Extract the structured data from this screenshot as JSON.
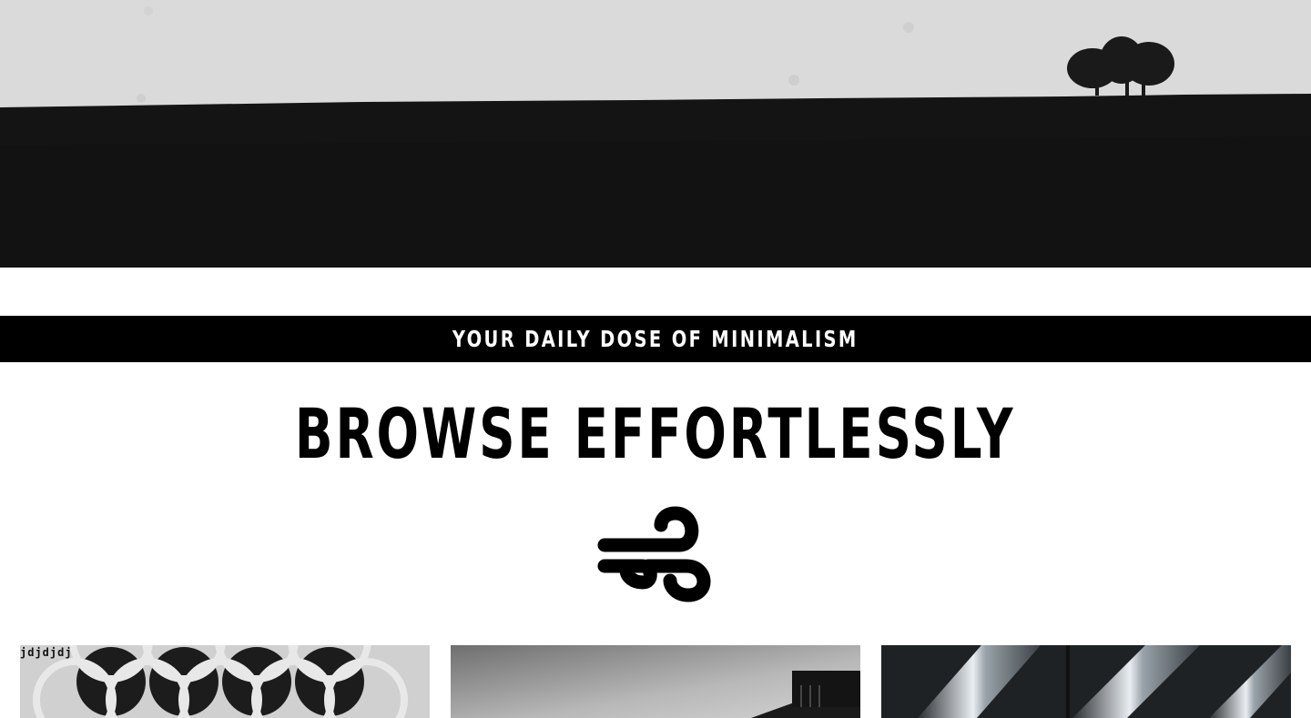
{
  "banner": {
    "text": "YOUR DAILY DOSE OF MINIMALISM"
  },
  "heading": {
    "text": "BROWSE EFFORTLESSLY"
  },
  "icons": {
    "decoration": "wind-icon"
  },
  "gallery": {
    "caption": "jdjdjdj",
    "cards": [
      {
        "subject": "geometric-circles-pattern"
      },
      {
        "subject": "building-rooftop-sky"
      },
      {
        "subject": "metallic-diagonal-bars"
      }
    ]
  },
  "colors": {
    "banner_bg": "#000000",
    "banner_text": "#ffffff",
    "heading": "#000000",
    "page_bg": "#ffffff"
  }
}
